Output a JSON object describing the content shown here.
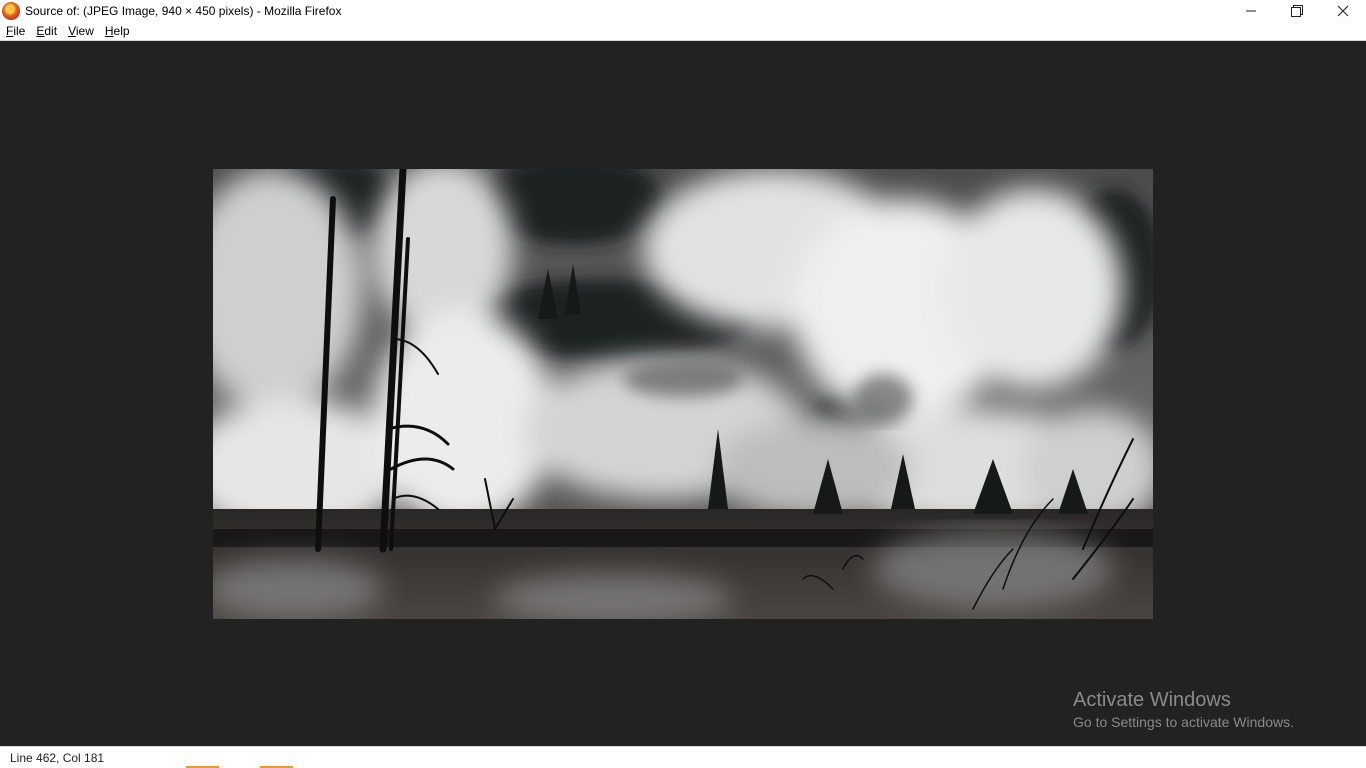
{
  "window": {
    "title": "Source of: (JPEG Image, 940 × 450 pixels) - Mozilla Firefox",
    "app_icon": "firefox-icon",
    "controls": [
      "minimize-icon",
      "restore-icon",
      "close-icon"
    ]
  },
  "menubar": {
    "items": [
      {
        "label": "File",
        "accesskey": "F"
      },
      {
        "label": "Edit",
        "accesskey": "E"
      },
      {
        "label": "View",
        "accesskey": "V"
      },
      {
        "label": "Help",
        "accesskey": "H"
      }
    ]
  },
  "content": {
    "background": "#222222",
    "image": {
      "description_icon": "steaming-landscape-photo"
    }
  },
  "watermark": {
    "title": "Activate Windows",
    "subtitle": "Go to Settings to activate Windows."
  },
  "statusbar": {
    "position": "Line 462, Col 181"
  }
}
